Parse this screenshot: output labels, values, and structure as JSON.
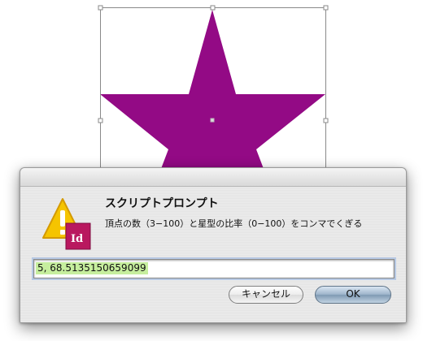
{
  "canvas": {
    "star_color": "#930a85",
    "frame_color": "#a0a0a0"
  },
  "dialog": {
    "title": "スクリプトプロンプト",
    "message": "頂点の数（3−100）と星型の比率（0−100）をコンマでくぎる",
    "input_value": "5, 68.5135150659099",
    "cancel_label": "キャンセル",
    "ok_label": "OK",
    "icon": "warning-icon",
    "app_badge": "Id",
    "app_badge_color": "#b9185f",
    "warning_color": "#f5c400"
  }
}
